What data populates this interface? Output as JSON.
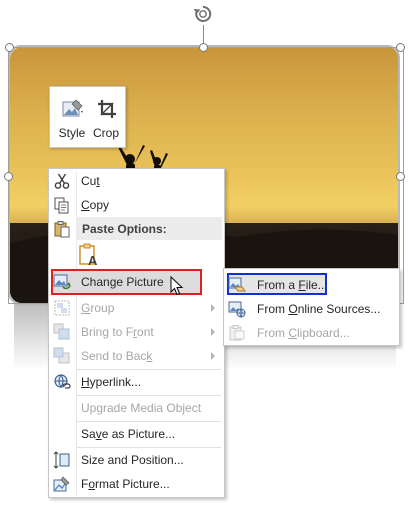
{
  "mini_toolbar": {
    "style_label": "Style",
    "crop_label": "Crop"
  },
  "context_menu": {
    "cut": {
      "before": "Cu",
      "key": "t",
      "after": ""
    },
    "copy": {
      "before": "",
      "key": "C",
      "after": "opy"
    },
    "paste_options_label": "Paste Options:",
    "change_picture": {
      "before": "Change Picture",
      "key": "",
      "after": ""
    },
    "group": {
      "before": "",
      "key": "G",
      "after": "roup"
    },
    "bring_to_front": {
      "before": "Bring to F",
      "key": "r",
      "after": "ont"
    },
    "send_to_back": {
      "before": "Send to Bac",
      "key": "k",
      "after": ""
    },
    "hyperlink": {
      "before": "",
      "key": "H",
      "after": "yperlink..."
    },
    "upgrade_media_object": "Upgrade Media Object",
    "save_as_picture": {
      "before": "Sa",
      "key": "v",
      "after": "e as Picture..."
    },
    "size_and_position": {
      "before": "Size and Position",
      "key": "",
      "after": "..."
    },
    "format_picture": {
      "before": "F",
      "key": "o",
      "after": "rmat Picture..."
    }
  },
  "submenu": {
    "from_a_file": {
      "before": "From a ",
      "key": "F",
      "after": "ile..."
    },
    "from_online_sources": {
      "before": "From ",
      "key": "O",
      "after": "nline Sources..."
    },
    "from_clipboard": {
      "before": "From ",
      "key": "C",
      "after": "lipboard..."
    }
  },
  "colors": {
    "highlight_red": "#e02020",
    "highlight_blue": "#1030d8",
    "disabled_text": "#a6a6a6"
  }
}
